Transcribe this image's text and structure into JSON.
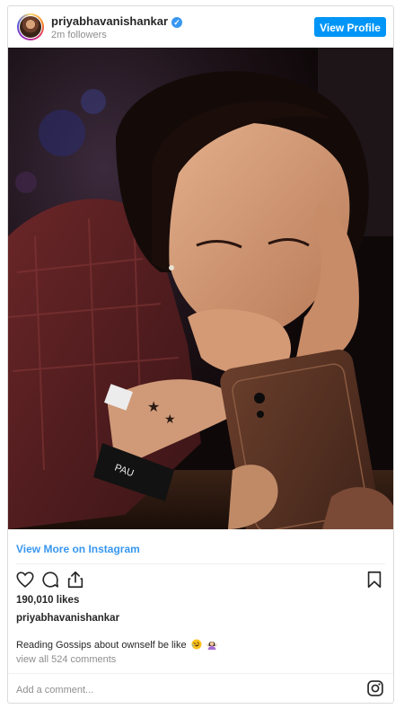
{
  "post": {
    "username": "priyabhavanishankar",
    "verified_icon": "verified-badge-icon",
    "followers": "2m followers",
    "view_profile_label": "View Profile",
    "view_more_label": "View More on Instagram",
    "likes": "190,010 likes",
    "caption_owner": "priyabhavanishankar",
    "caption": "Reading Gossips about ownself be like",
    "caption_emojis": [
      "rolling-on-floor-laughing-emoji",
      "woman-shrugging-emoji"
    ],
    "view_all_comments": "view all 524 comments",
    "comment_placeholder": "Add a comment..."
  },
  "icons": {
    "like": "heart-icon",
    "comment": "comment-bubble-icon",
    "share": "share-icon",
    "save": "bookmark-icon",
    "instagram": "instagram-logo-icon"
  },
  "colors": {
    "accent": "#0095f6",
    "link": "#3897f0",
    "text": "#262626",
    "muted": "#8e8e8e",
    "border": "#dbdbdb"
  }
}
